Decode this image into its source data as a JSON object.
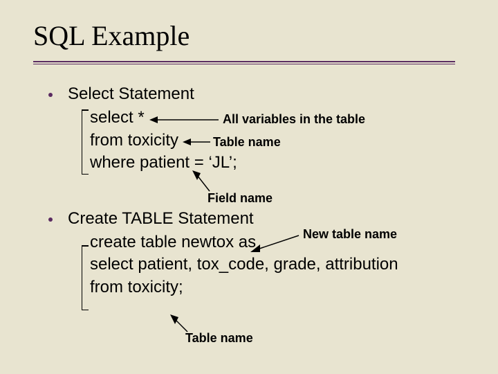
{
  "title": "SQL Example",
  "bullets": {
    "b1": {
      "head": "Select Statement",
      "l1": "select *",
      "l2": "from toxicity",
      "l3": "where patient = ‘JL’;"
    },
    "b2": {
      "head": "Create TABLE Statement",
      "l1": "create table newtox as",
      "l2": "select patient, tox_code, grade, attribution",
      "l3": "from toxicity;"
    }
  },
  "annotations": {
    "a1": "All variables in the table",
    "a2": "Table name",
    "a3": "Field name",
    "a4": "New table name",
    "a5": "Table name"
  }
}
